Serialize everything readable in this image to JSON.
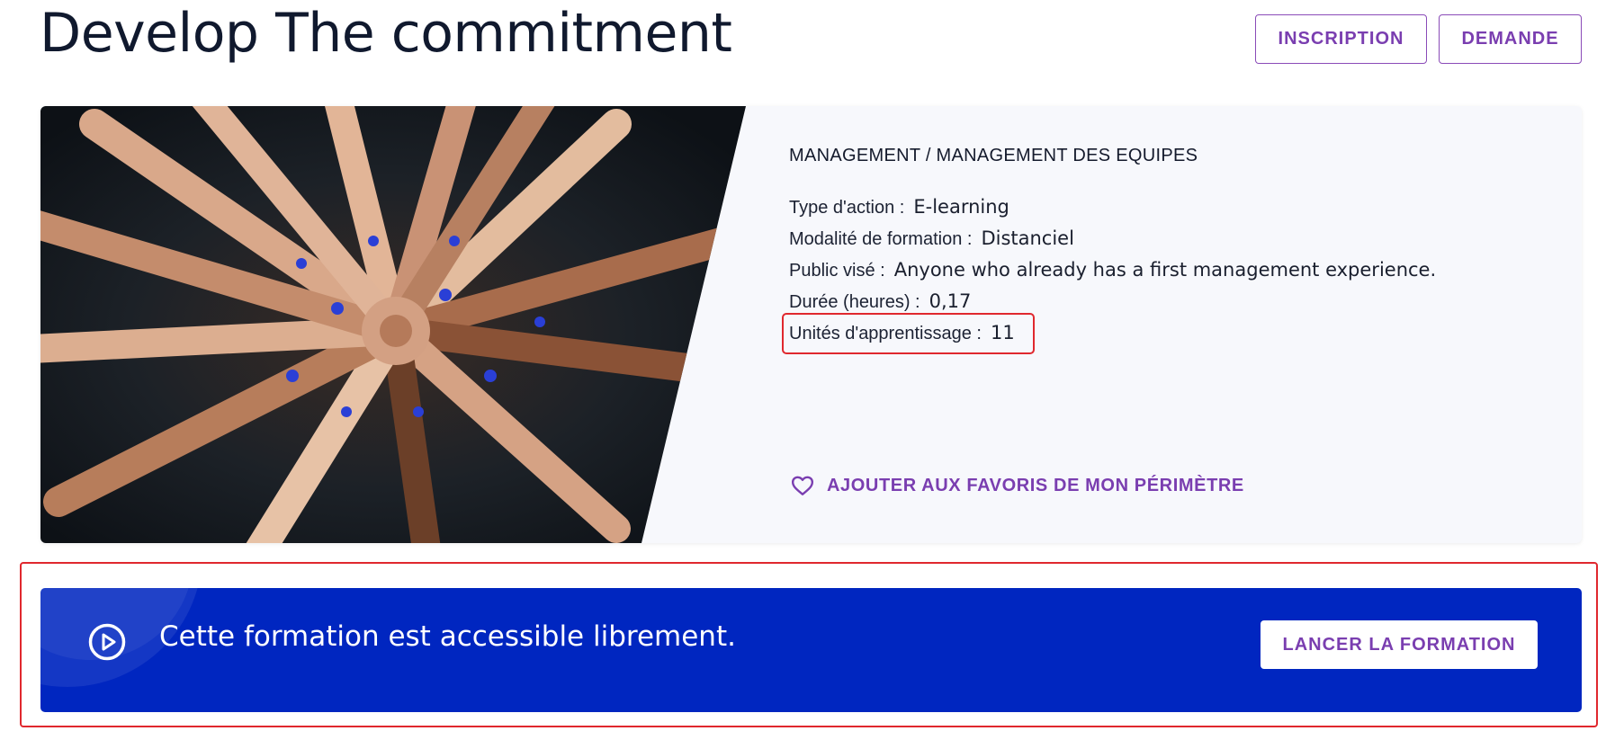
{
  "page": {
    "title": "Develop The commitment"
  },
  "header_actions": {
    "inscription_label": "INSCRIPTION",
    "demande_label": "DEMANDE"
  },
  "course": {
    "category": "MANAGEMENT / MANAGEMENT DES EQUIPES",
    "details": [
      {
        "label": "Type d'action :",
        "value": "E-learning"
      },
      {
        "label": "Modalité de formation :",
        "value": "Distanciel"
      },
      {
        "label": "Public visé :",
        "value": "Anyone who already has a first management experience."
      },
      {
        "label": "Durée (heures) :",
        "value": "0,17"
      },
      {
        "label": "Unités d'apprentissage :",
        "value": "11"
      }
    ],
    "favorite_label": "AJOUTER AUX FAVORIS DE MON PÉRIMÈTRE",
    "image": "team-hands-together-photo"
  },
  "banner": {
    "message": "Cette formation est accessible librement.",
    "launch_label": "LANCER LA FORMATION",
    "icon": "play-circle-icon"
  },
  "colors": {
    "accent_purple": "#7a3eb0",
    "banner_blue": "#0026c0",
    "highlight_red": "#e0282e",
    "title_dark": "#10192e"
  }
}
